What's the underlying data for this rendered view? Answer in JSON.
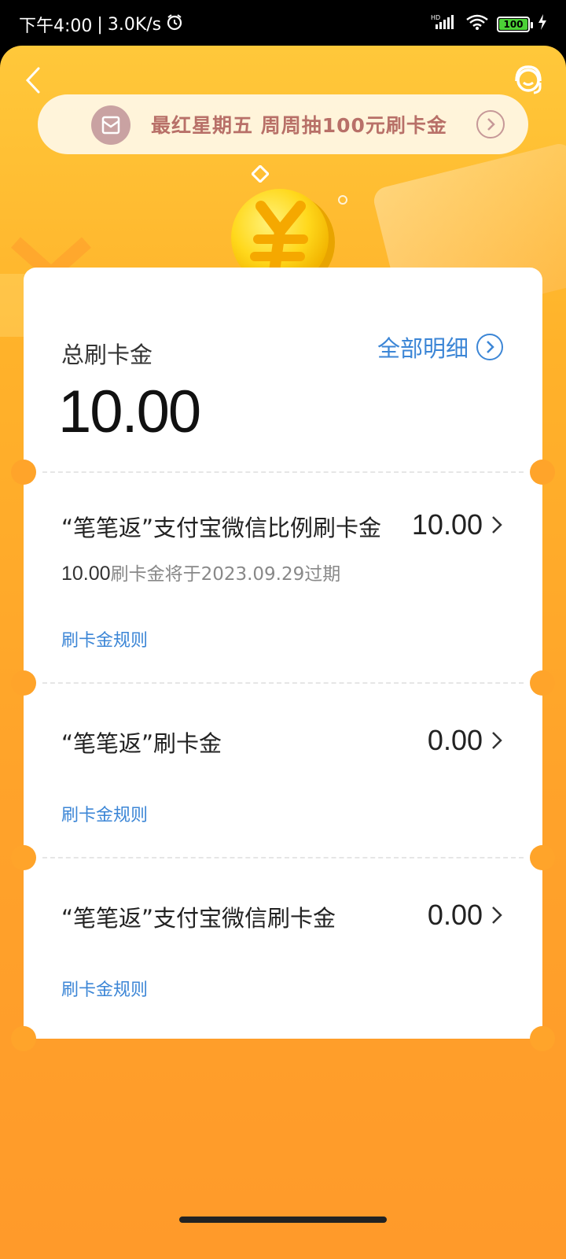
{
  "status_bar": {
    "time": "下午4:00",
    "speed": "3.0K/s",
    "battery": "100"
  },
  "banner": {
    "text": "最红星期五 周周抽100元刷卡金"
  },
  "summary": {
    "label": "总刷卡金",
    "detail_link": "全部明细",
    "total": "10.00"
  },
  "sections": [
    {
      "title": "“笔笔返”支付宝微信比例刷卡金",
      "value": "10.00",
      "expire_amount": "10.00",
      "expire_text": "刷卡金将于2023.09.29过期",
      "rule": "刷卡金规则"
    },
    {
      "title": "“笔笔返”刷卡金",
      "value": "0.00",
      "rule": "刷卡金规则"
    },
    {
      "title": "“笔笔返”支付宝微信刷卡金",
      "value": "0.00",
      "rule": "刷卡金规则"
    }
  ],
  "colors": {
    "accent": "#3c86d6",
    "background": "#ffa42a"
  }
}
